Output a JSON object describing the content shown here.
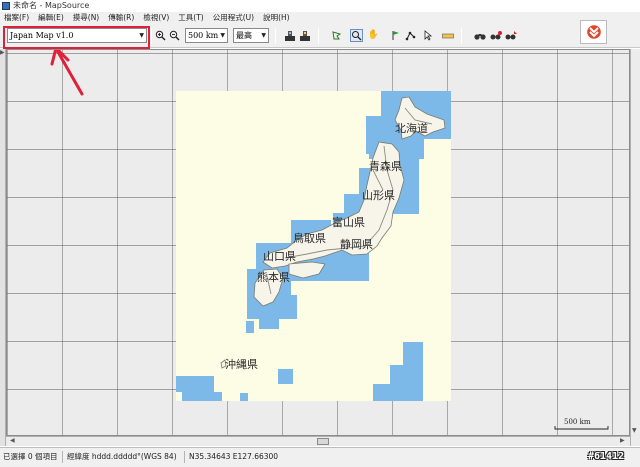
{
  "window": {
    "title": "未命名 - MapSource"
  },
  "menu": [
    "檔案(F)",
    "編輯(E)",
    "摸尋(N)",
    "傳輸(R)",
    "檢視(V)",
    "工具(T)",
    "公用程式(U)",
    "說明(H)"
  ],
  "toolbar": {
    "map_product": "Japan Map v1.0",
    "zoom_scale": "500 km",
    "detail_level": "最高"
  },
  "map": {
    "labels": [
      "北海道",
      "青森県",
      "山形県",
      "富山県",
      "鳥取県",
      "静岡県",
      "山口県",
      "熊本県",
      "沖縄県"
    ],
    "scale_label": "500 km"
  },
  "status": {
    "selection": "已選擇 0 個項目",
    "format": "經緯度 hddd.ddddd°(WGS 84)",
    "coordinates": "N35.34643 E127.66300"
  },
  "watermark": "#61412",
  "colors": {
    "water": "#7cb8e8",
    "land_bg": "#fdfde6",
    "grid": "#555555",
    "highlight": "#e0203a"
  }
}
